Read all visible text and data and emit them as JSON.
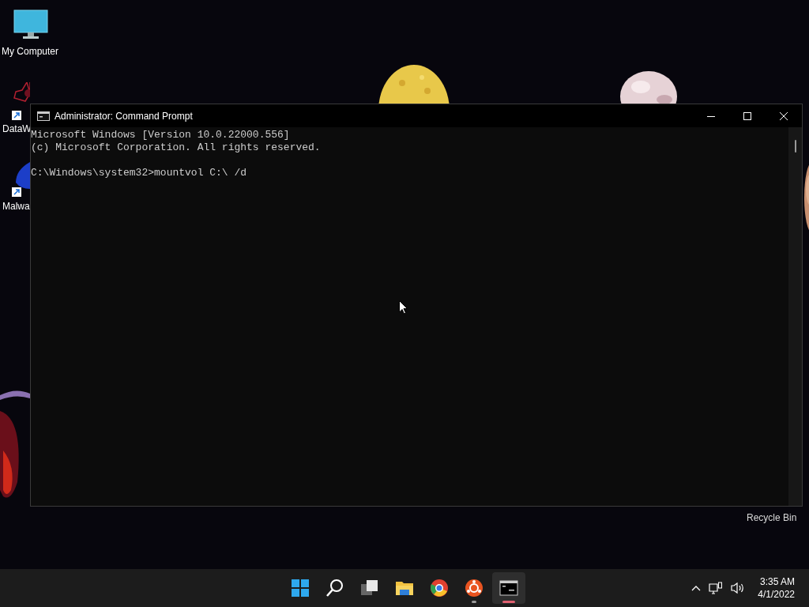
{
  "desktop_icons": [
    {
      "kind": "monitor",
      "label": "My Computer",
      "shortcut": false
    },
    {
      "kind": "star",
      "label": "DataW",
      "shortcut": true
    },
    {
      "kind": "wing",
      "label": "Malwa",
      "shortcut": true
    }
  ],
  "window": {
    "title": "Administrator: Command Prompt",
    "banner_lines": [
      "Microsoft Windows [Version 10.0.22000.556]",
      "(c) Microsoft Corporation. All rights reserved."
    ],
    "command_line": "C:\\Windows\\system32>mountvol C:\\ /d"
  },
  "recycle_bin": {
    "label": "Recycle Bin"
  },
  "taskbar": {
    "items": [
      {
        "kind": "start",
        "running": false,
        "selected": false
      },
      {
        "kind": "search",
        "running": false,
        "selected": false
      },
      {
        "kind": "taskview",
        "running": false,
        "selected": false
      },
      {
        "kind": "folder",
        "running": false,
        "selected": false
      },
      {
        "kind": "browser",
        "running": false,
        "selected": false
      },
      {
        "kind": "ring",
        "running": true,
        "selected": false
      },
      {
        "kind": "terminal",
        "running": true,
        "selected": true
      }
    ],
    "clock": {
      "time": "3:35 AM",
      "date": "4/1/2022"
    }
  }
}
